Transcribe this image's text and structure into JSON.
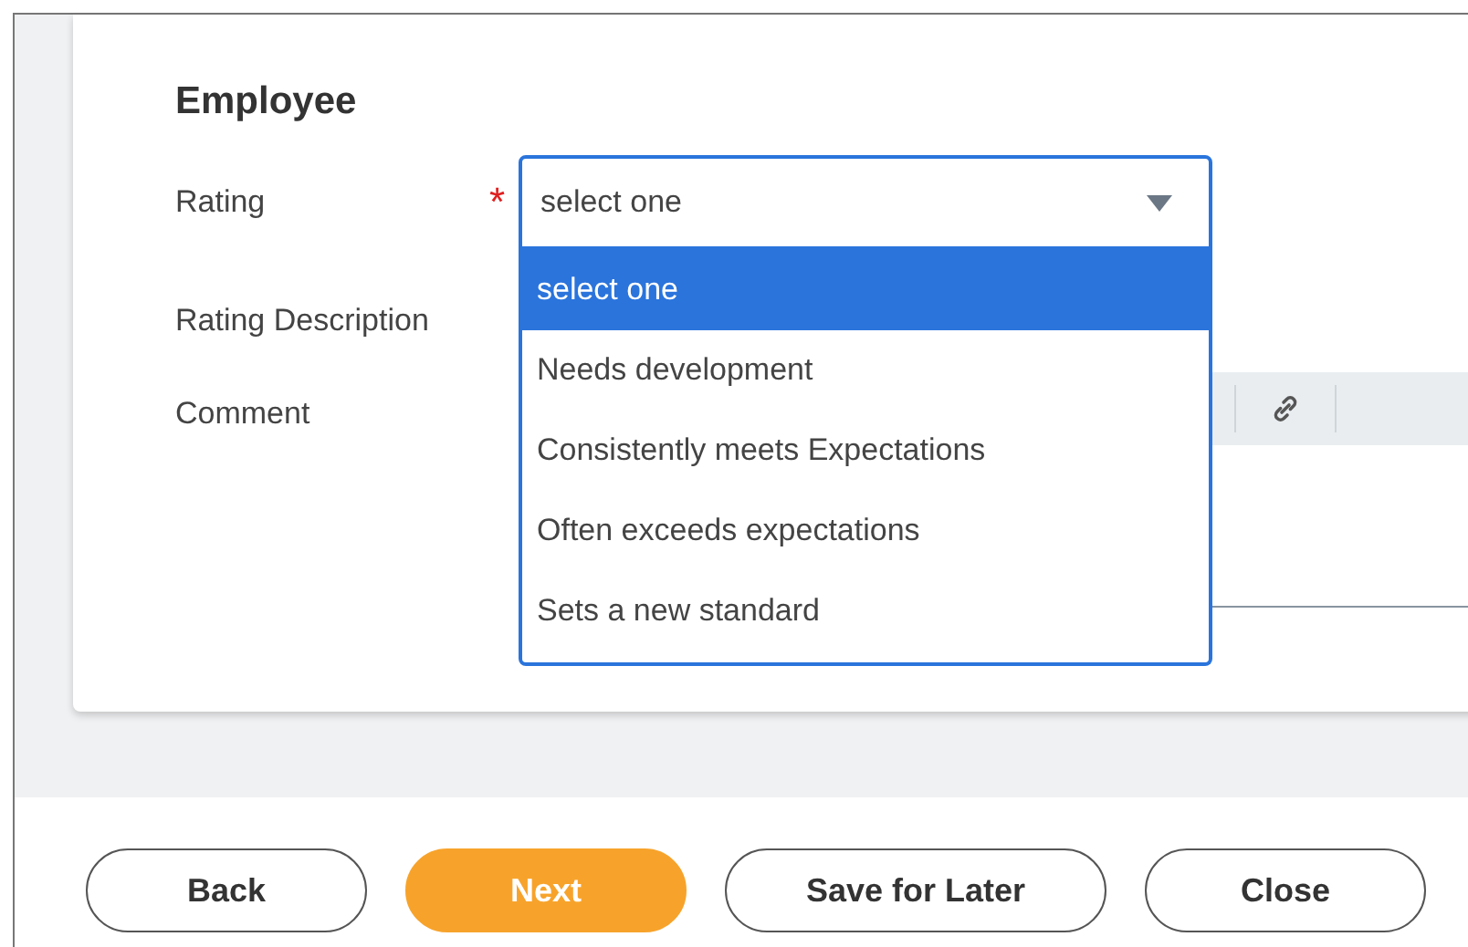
{
  "section": {
    "title": "Employee"
  },
  "fields": [
    {
      "kind": "select",
      "label": "Rating",
      "required_mark": "*",
      "value": "select one",
      "expanded": true,
      "options": [
        {
          "label": "select one",
          "selected": true
        },
        {
          "label": "Needs development",
          "selected": false
        },
        {
          "label": "Consistently meets Expectations",
          "selected": false
        },
        {
          "label": "Often exceeds expectations",
          "selected": false
        },
        {
          "label": "Sets a new standard",
          "selected": false
        }
      ]
    },
    {
      "kind": "text",
      "label": "Rating Description"
    },
    {
      "kind": "editor",
      "label": "Comment"
    }
  ],
  "buttons": [
    {
      "label": "Back",
      "primary": false
    },
    {
      "label": "Next",
      "primary": true
    },
    {
      "label": "Save for Later",
      "primary": false
    },
    {
      "label": "Close",
      "primary": false
    }
  ]
}
